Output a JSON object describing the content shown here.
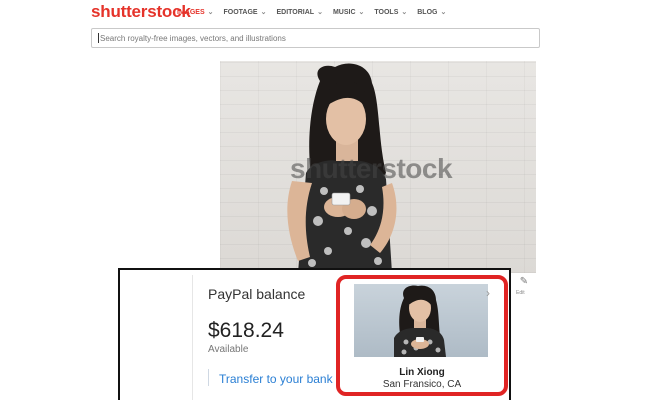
{
  "header": {
    "logo": "shutterstock",
    "nav": [
      {
        "label": "IMAGES",
        "active": true
      },
      {
        "label": "FOOTAGE",
        "active": false
      },
      {
        "label": "EDITORIAL",
        "active": false
      },
      {
        "label": "MUSIC",
        "active": false
      },
      {
        "label": "TOOLS",
        "active": false
      },
      {
        "label": "BLOG",
        "active": false
      }
    ],
    "search_placeholder": "Search royalty-free images, vectors, and illustrations"
  },
  "photo": {
    "watermark": "shutterstock",
    "edit_label": "Edit"
  },
  "paypal": {
    "title": "PayPal balance",
    "amount": "$618.24",
    "available_label": "Available",
    "transfer_label": "Transfer to your bank"
  },
  "profile_card": {
    "name": "Lin Xiong",
    "location": "San Fransico, CA"
  },
  "colors": {
    "brand_red": "#e5332a",
    "highlight_red": "#e02424",
    "link_blue": "#2a7fd4"
  }
}
